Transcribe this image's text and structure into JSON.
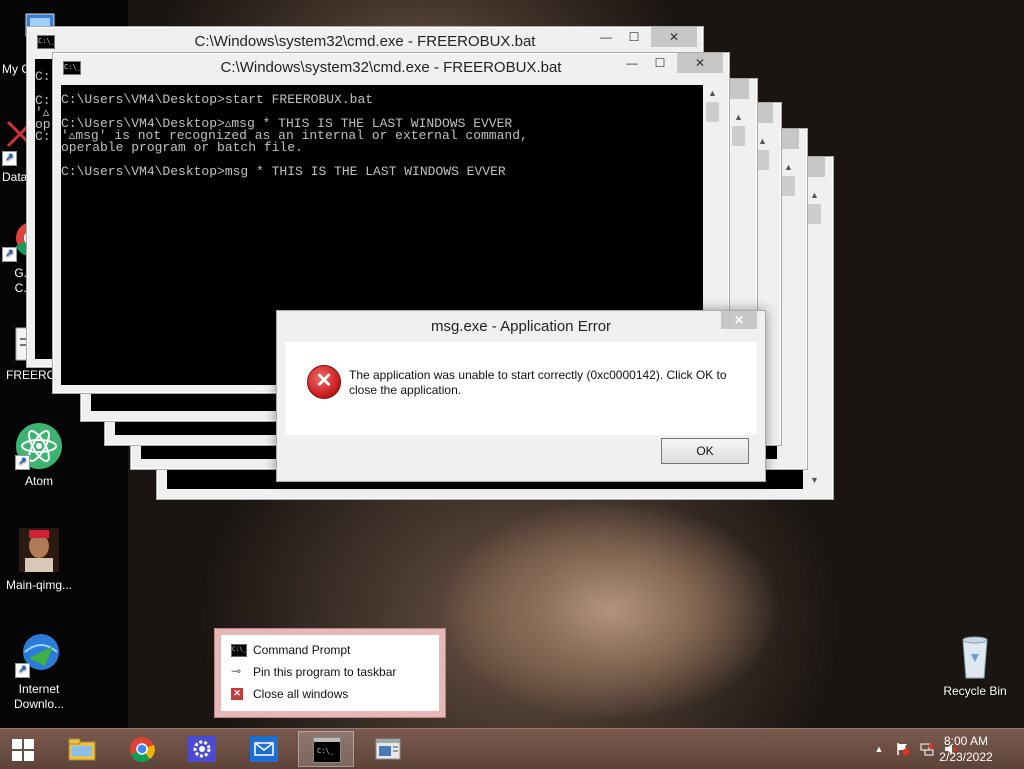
{
  "desktop": {
    "icons": [
      {
        "name": "my-computer",
        "label": "My C..."
      },
      {
        "name": "data",
        "label": "Data..."
      },
      {
        "name": "google-chrome",
        "label": "G... C..."
      },
      {
        "name": "freerobux",
        "label": "FREEROB..."
      },
      {
        "name": "atom",
        "label": "Atom"
      },
      {
        "name": "main-qimg",
        "label": "Main-qimg..."
      },
      {
        "name": "internet-download-manager",
        "label": "Internet Downlo..."
      }
    ],
    "recycle_bin": {
      "label": "Recycle Bin"
    }
  },
  "cmd_window": {
    "title": "C:\\Windows\\system32\\cmd.exe - FREEROBUX.bat",
    "icon_text": "C:\\_",
    "min_glyph": "—",
    "max_glyph": "☐",
    "close_glyph": "✕",
    "console_lines": [
      "C:\\Users\\VM4\\Desktop>start FREEROBUX.bat",
      "",
      "C:\\Users\\VM4\\Desktop>▵msg * THIS IS THE LAST WINDOWS EVVER",
      "'▵msg' is not recognized as an internal or external command,",
      "operable program or batch file.",
      "",
      "C:\\Users\\VM4\\Desktop>msg * THIS IS THE LAST WINDOWS EVVER"
    ],
    "back_fragments": [
      "C:",
      "C:",
      "'▵",
      "op",
      "C:"
    ]
  },
  "error_dialog": {
    "title": "msg.exe - Application Error",
    "close_glyph": "✕",
    "icon_glyph": "✕",
    "message": "The application was unable to start correctly (0xc0000142). Click OK to close the application.",
    "ok_label": "OK"
  },
  "jumplist": {
    "items": [
      {
        "label": "Command Prompt"
      },
      {
        "label": "Pin this program to taskbar"
      },
      {
        "label": "Close all windows"
      }
    ]
  },
  "taskbar": {
    "items": [
      "file-explorer",
      "google-chrome",
      "settings",
      "mail",
      "command-prompt",
      "window"
    ],
    "active": "command-prompt"
  },
  "tray": {
    "time": "8:00 AM",
    "date": "2/23/2022",
    "show_hidden_glyph": "▲"
  },
  "colors": {
    "console_bg": "#000000",
    "console_text": "#c0c0c0",
    "taskbar": "#6a4c40",
    "jumplist_border": "#e6b8b8",
    "error_red": "#c41818"
  }
}
